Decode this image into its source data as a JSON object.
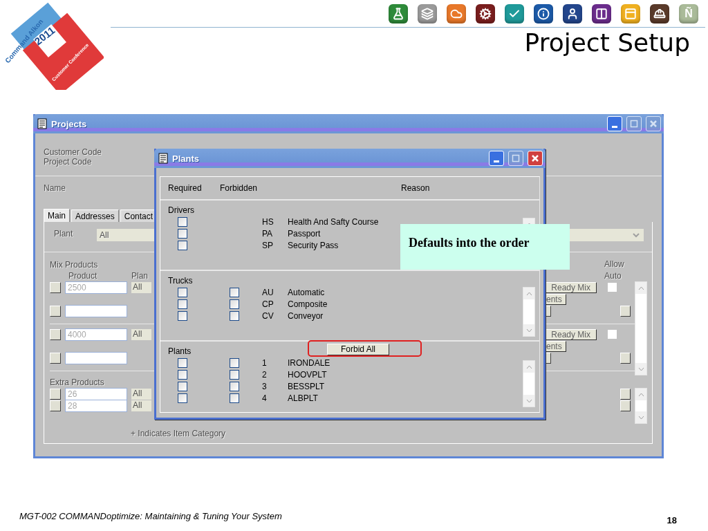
{
  "slide": {
    "title": "Project Setup",
    "footer": "MGT-002 COMMANDoptimize: Maintaining & Tuning Your System",
    "page": "18",
    "logo": {
      "brand": "Command Alkon",
      "year": "2011",
      "event": "Customer Conference"
    },
    "icons": [
      {
        "kind": "flask",
        "color": "#2e8b3a"
      },
      {
        "kind": "layers",
        "color": "#9a9a9a"
      },
      {
        "kind": "cloud",
        "color": "#e8782a"
      },
      {
        "kind": "gear",
        "color": "#7a1e1e"
      },
      {
        "kind": "check",
        "color": "#1f9a9a"
      },
      {
        "kind": "info",
        "color": "#1c5aa8"
      },
      {
        "kind": "person",
        "color": "#23468c"
      },
      {
        "kind": "columns",
        "color": "#6b2c8c"
      },
      {
        "kind": "panel",
        "color": "#f0b020"
      },
      {
        "kind": "hardhat",
        "color": "#5a3a2a"
      },
      {
        "kind": "letter",
        "color": "#aabb99",
        "text": "Ñ"
      }
    ]
  },
  "projects_window": {
    "title": "Projects",
    "inactive": true,
    "controls": [
      {
        "kind": "minimize",
        "disabled": false
      },
      {
        "kind": "maximize",
        "disabled": true
      },
      {
        "kind": "close",
        "disabled": true
      }
    ],
    "fields": [
      "Customer Code",
      "Project Code"
    ],
    "name_label": "Name",
    "tabs": [
      {
        "label": "Main",
        "selected": true
      },
      {
        "label": "Addresses",
        "selected": false
      },
      {
        "label": "Contact",
        "selected": false
      }
    ],
    "plant": {
      "label": "Plant",
      "value": "All"
    },
    "mix_products": {
      "label": "Mix Products",
      "columns": [
        "Product",
        "Plan"
      ],
      "right_columns": [
        "Allow",
        "Auto"
      ],
      "groups": [
        {
          "rows": [
            {
              "kind": "filled",
              "product": "2500",
              "plant": "All"
            },
            {
              "kind": "blank"
            }
          ],
          "ready_mix": "Ready Mix",
          "other_button": "ents",
          "allow_auto": false
        },
        {
          "rows": [
            {
              "kind": "filled",
              "product": "4000",
              "plant": "All"
            },
            {
              "kind": "blank"
            }
          ],
          "ready_mix": "Ready Mix",
          "other_button": "ents",
          "allow_auto": false
        }
      ]
    },
    "extra_products": {
      "label": "Extra Products",
      "rows": [
        {
          "product": "26",
          "plant": "All"
        },
        {
          "product": "28",
          "plant": "All"
        }
      ]
    },
    "note": "+ Indicates Item Category"
  },
  "plants_dialog": {
    "title": "Plants",
    "controls": [
      {
        "kind": "minimize",
        "disabled": false
      },
      {
        "kind": "maximize",
        "disabled": true
      },
      {
        "kind": "close",
        "disabled": false
      }
    ],
    "columns": [
      "Required",
      "Forbidden",
      "Reason"
    ],
    "sections": [
      {
        "kind": "required_only",
        "title": "Drivers",
        "items": [
          {
            "code": "HS",
            "name": "Health And Safty Course",
            "required": false
          },
          {
            "code": "PA",
            "name": "Passport",
            "required": false
          },
          {
            "code": "SP",
            "name": "Security Pass",
            "required": false
          }
        ]
      },
      {
        "kind": "both",
        "title": "Trucks",
        "items": [
          {
            "code": "AU",
            "name": "Automatic",
            "required": false,
            "forbidden": false
          },
          {
            "code": "CP",
            "name": "Composite",
            "required": false,
            "forbidden": false
          },
          {
            "code": "CV",
            "name": "Conveyor",
            "required": false,
            "forbidden": false
          }
        ]
      },
      {
        "kind": "both",
        "title": "Plants",
        "button": "Forbid All",
        "highlighted": true,
        "items": [
          {
            "code": "1",
            "name": "IRONDALE",
            "required": false,
            "forbidden": false
          },
          {
            "code": "2",
            "name": "HOOVPLT",
            "required": false,
            "forbidden": false
          },
          {
            "code": "3",
            "name": "BESSPLT",
            "required": false,
            "forbidden": false
          },
          {
            "code": "4",
            "name": "ALBPLT",
            "required": false,
            "forbidden": false
          }
        ]
      }
    ]
  },
  "callout": {
    "text": "Defaults into the order"
  }
}
